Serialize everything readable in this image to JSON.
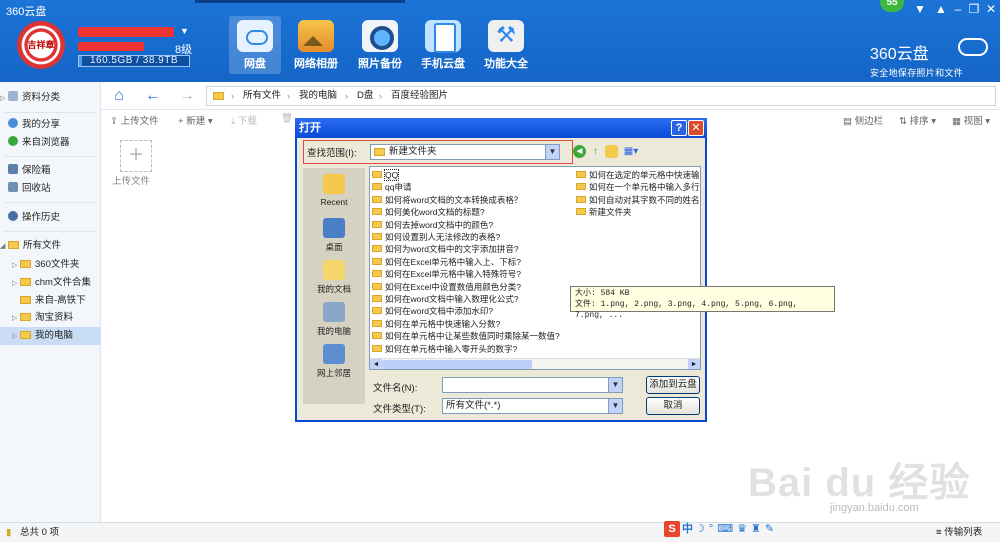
{
  "app": {
    "title": "360云盘"
  },
  "user": {
    "level": "8级",
    "quota": "160.5GB / 38.9TB",
    "quota_fraction": 0.004,
    "avatar_text": "吉祥章"
  },
  "nav": [
    {
      "label": "网盘",
      "icon": "cloud-drive-icon",
      "active": true
    },
    {
      "label": "网络相册",
      "icon": "photo-album-icon"
    },
    {
      "label": "照片备份",
      "icon": "camera-icon"
    },
    {
      "label": "手机云盘",
      "icon": "phone-cloud-icon"
    },
    {
      "label": "功能大全",
      "icon": "toolbox-icon"
    }
  ],
  "window": {
    "notification_count": "55"
  },
  "brand": {
    "name": "360云盘",
    "slogan": "安全地保存照片和文件"
  },
  "sidebar": {
    "items": [
      {
        "label": "资料分类"
      },
      {
        "label": "我的分享"
      },
      {
        "label": "来自浏览器"
      },
      {
        "label": "保险箱"
      },
      {
        "label": "回收站"
      },
      {
        "label": "操作历史"
      },
      {
        "label": "所有文件"
      },
      {
        "label": "360文件夹"
      },
      {
        "label": "chm文件合集"
      },
      {
        "label": "来自-高铁下"
      },
      {
        "label": "淘宝资料"
      },
      {
        "label": "我的电脑"
      }
    ]
  },
  "breadcrumb": [
    "所有文件",
    "我的电脑",
    "D盘",
    "百度经验图片"
  ],
  "toolbar": {
    "upload": "上传文件",
    "new": "新建",
    "download": "下载",
    "sidebar": "侧边栏",
    "sort": "排序",
    "view": "视图"
  },
  "content": {
    "upload_tile_label": "上传文件"
  },
  "status": {
    "count": "总共 0 项",
    "transfer": "传输列表"
  },
  "ime": {
    "label": "中"
  },
  "dialog": {
    "title": "打开",
    "look_in_label": "查找范围(I):",
    "look_in_value": "新建文件夹",
    "places": [
      "Recent",
      "桌面",
      "我的文档",
      "我的电脑",
      "网上邻居"
    ],
    "files_col1": [
      "QQ",
      "qq申请",
      "如何将word文档的文本转换成表格？",
      "如何美化word文档的标题?",
      "如何去掉word文档中的颜色?",
      "如何设置别人无法修改的表格?",
      "如何为word文档中的文字添加拼音?",
      "如何在Excel单元格中输入上、下标?",
      "如何在Excel单元格中输入特殊符号?",
      "如何在Excel中设置数值用颜色分类?",
      "如何在word文档中输入数理化公式?",
      "如何在word文档中添加水印?",
      "如何在单元格中快速输入分数?",
      "如何在单元格中让某些数值同时乘除某一数值?",
      "如何在单元格中输入零开头的数字?"
    ],
    "files_col2": [
      "如何在选定的单元格中快速输",
      "如何在一个单元格中输入多行",
      "如何自动对其字数不同的姓名",
      "新建文件夹"
    ],
    "tooltip": {
      "size": "大小: 584 KB",
      "files": "文件: 1.png, 2.png, 3.png, 4.png, 5.png, 6.png, 7.png, ..."
    },
    "filename_label": "文件名(N):",
    "filename_value": "",
    "filetype_label": "文件类型(T):",
    "filetype_value": "所有文件(*.*)",
    "add_button": "添加到云盘",
    "cancel_button": "取消"
  },
  "watermark": {
    "text": "Bai du 经验",
    "url": "jingyan.baidu.com"
  }
}
